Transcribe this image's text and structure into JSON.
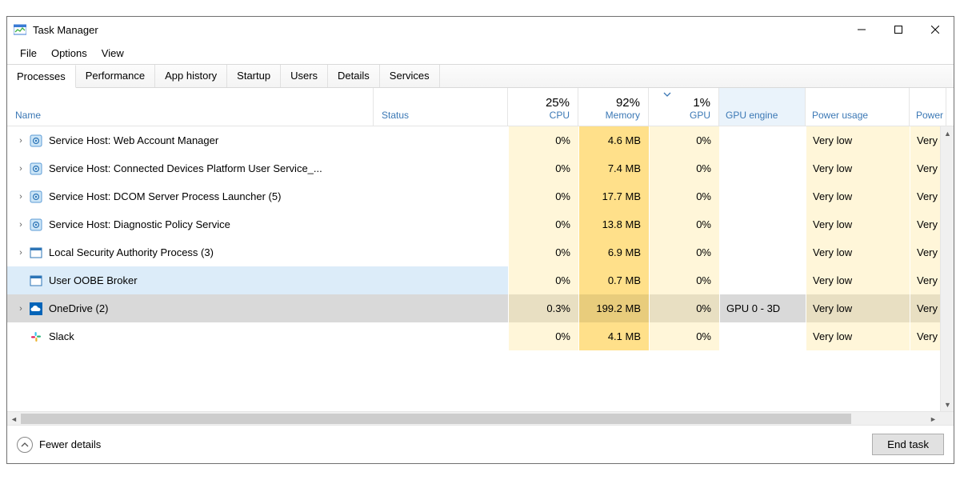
{
  "title": "Task Manager",
  "menubar": [
    "File",
    "Options",
    "View"
  ],
  "tabs": [
    {
      "label": "Processes",
      "active": true
    },
    {
      "label": "Performance",
      "active": false
    },
    {
      "label": "App history",
      "active": false
    },
    {
      "label": "Startup",
      "active": false
    },
    {
      "label": "Users",
      "active": false
    },
    {
      "label": "Details",
      "active": false
    },
    {
      "label": "Services",
      "active": false
    }
  ],
  "columns": {
    "name": {
      "label": "Name"
    },
    "status": {
      "label": "Status"
    },
    "cpu": {
      "pct": "25%",
      "label": "CPU"
    },
    "memory": {
      "pct": "92%",
      "label": "Memory"
    },
    "gpu": {
      "pct": "1%",
      "label": "GPU"
    },
    "gpu_engine": {
      "label": "GPU engine"
    },
    "power": {
      "label": "Power usage"
    },
    "power_trend": {
      "label": "Power u"
    }
  },
  "processes": [
    {
      "expandable": true,
      "icon": "gear",
      "name": "Service Host: Web Account Manager",
      "cpu": "0%",
      "mem": "4.6 MB",
      "gpu": "0%",
      "gpue": "",
      "pwr": "Very low",
      "pwrt": "Very"
    },
    {
      "expandable": true,
      "icon": "gear",
      "name": "Service Host: Connected Devices Platform User Service_...",
      "cpu": "0%",
      "mem": "7.4 MB",
      "gpu": "0%",
      "gpue": "",
      "pwr": "Very low",
      "pwrt": "Very"
    },
    {
      "expandable": true,
      "icon": "gear",
      "name": "Service Host: DCOM Server Process Launcher (5)",
      "cpu": "0%",
      "mem": "17.7 MB",
      "gpu": "0%",
      "gpue": "",
      "pwr": "Very low",
      "pwrt": "Very"
    },
    {
      "expandable": true,
      "icon": "gear",
      "name": "Service Host: Diagnostic Policy Service",
      "cpu": "0%",
      "mem": "13.8 MB",
      "gpu": "0%",
      "gpue": "",
      "pwr": "Very low",
      "pwrt": "Very"
    },
    {
      "expandable": true,
      "icon": "window",
      "name": "Local Security Authority Process (3)",
      "cpu": "0%",
      "mem": "6.9 MB",
      "gpu": "0%",
      "gpue": "",
      "pwr": "Very low",
      "pwrt": "Very"
    },
    {
      "expandable": false,
      "icon": "window",
      "name": "User OOBE Broker",
      "cpu": "0%",
      "mem": "0.7 MB",
      "gpu": "0%",
      "gpue": "",
      "pwr": "Very low",
      "pwrt": "Very",
      "state": "sel"
    },
    {
      "expandable": true,
      "icon": "onedrive",
      "name": "OneDrive (2)",
      "cpu": "0.3%",
      "mem": "199.2 MB",
      "gpu": "0%",
      "gpue": "GPU 0 - 3D",
      "pwr": "Very low",
      "pwrt": "Very",
      "state": "sel2"
    },
    {
      "expandable": false,
      "icon": "slack",
      "name": "Slack",
      "cpu": "0%",
      "mem": "4.1 MB",
      "gpu": "0%",
      "gpue": "",
      "pwr": "Very low",
      "pwrt": "Very"
    }
  ],
  "footer": {
    "fewer": "Fewer details",
    "endtask": "End task"
  }
}
